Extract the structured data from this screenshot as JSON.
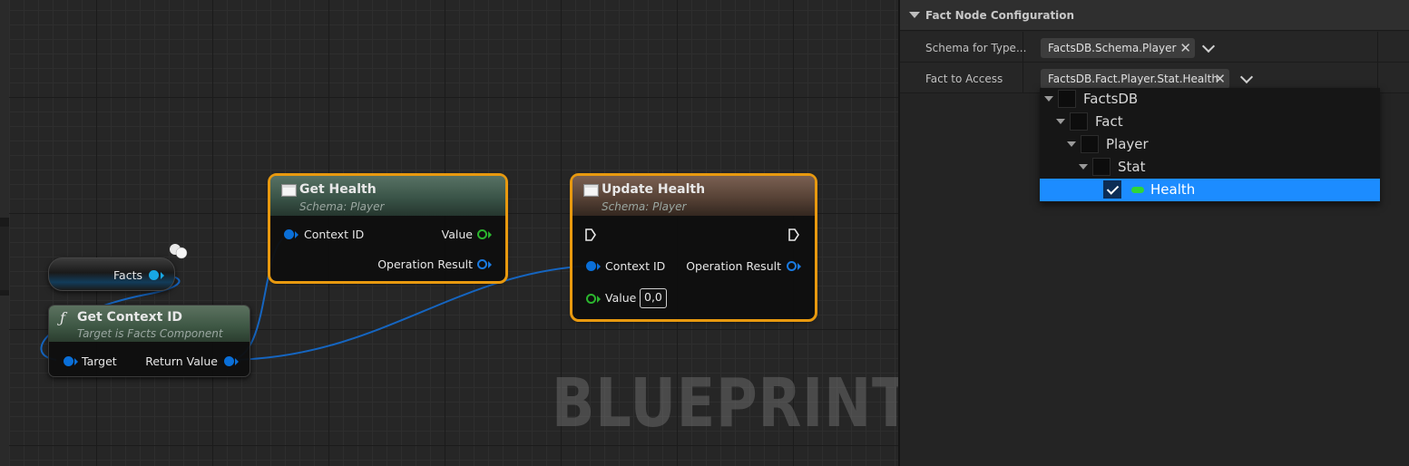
{
  "graph": {
    "watermark": "BLUEPRINT",
    "facts_variable": {
      "label": "Facts"
    },
    "get_context_id": {
      "icon": "function-icon",
      "title": "Get Context ID",
      "subtitle": "Target is Facts Component",
      "pin_in": "Target",
      "pin_out": "Return Value"
    },
    "get_health": {
      "title": "Get Health",
      "subtitle": "Schema: Player",
      "pin_in": "Context ID",
      "pin_out_value": "Value",
      "pin_out_result": "Operation Result"
    },
    "update_health": {
      "title": "Update Health",
      "subtitle": "Schema: Player",
      "pin_in": "Context ID",
      "pin_in_value": "Value",
      "value_default": "0,0",
      "pin_out_result": "Operation Result"
    }
  },
  "panel": {
    "category": "Fact Node Configuration",
    "rows": [
      {
        "name": "Schema for Type...",
        "value": "FactsDB.Schema.Player"
      },
      {
        "name": "Fact to Access",
        "value": "FactsDB.Fact.Player.Stat.Health"
      }
    ],
    "tree": [
      {
        "label": "FactsDB",
        "depth": 0,
        "checked": false
      },
      {
        "label": "Fact",
        "depth": 1,
        "checked": false
      },
      {
        "label": "Player",
        "depth": 2,
        "checked": false
      },
      {
        "label": "Stat",
        "depth": 3,
        "checked": false
      },
      {
        "label": "Health",
        "depth": 4,
        "checked": true,
        "selected": true
      }
    ]
  },
  "colors": {
    "selection_outline": "#e8990f",
    "tree_selected": "#1c8cff",
    "pin_blue": "#0a6fd8",
    "pin_green": "#2bb52e",
    "wire": "#1565c0"
  }
}
